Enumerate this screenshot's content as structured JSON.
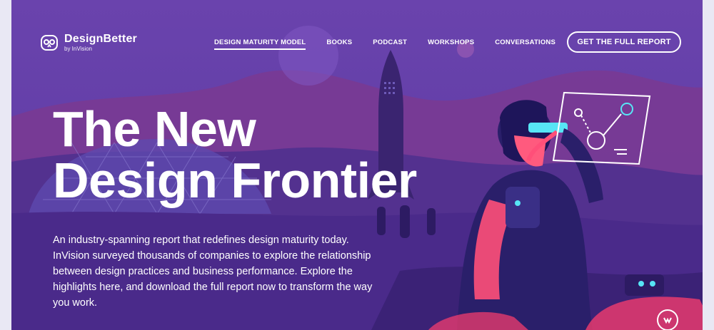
{
  "brand": {
    "name": "DesignBetter",
    "sub": "by InVision"
  },
  "nav": {
    "items": [
      "DESIGN MATURITY MODEL",
      "BOOKS",
      "PODCAST",
      "WORKSHOPS",
      "CONVERSATIONS"
    ],
    "active_index": 0,
    "cta": "GET THE FULL REPORT"
  },
  "hero": {
    "title_line1": "The New",
    "title_line2": "Design Frontier",
    "body": "An industry-spanning report that redefines design maturity today. InVision surveyed thousands of companies to explore the relationship between design practices and business performance. Explore the highlights here, and download the full report now to transform the way you work."
  },
  "colors": {
    "background": "#5b3aa0",
    "accent_pink": "#ff4f79",
    "accent_cyan": "#57e6f5",
    "white": "#ffffff"
  },
  "icons": {
    "logo": "owl-icon",
    "badge": "invision-logo-icon"
  }
}
